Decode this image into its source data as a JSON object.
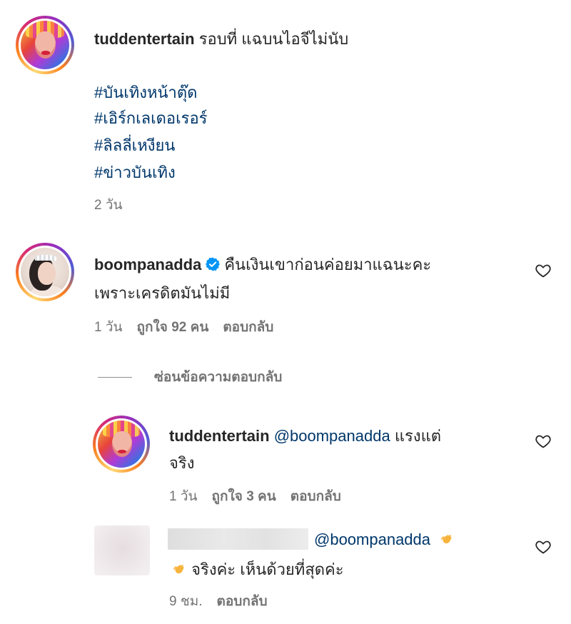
{
  "comments": [
    {
      "username": "tuddentertain",
      "text": "รอบที่ แฉบนไอจีไม่นับ",
      "hashtags": [
        "#บันเทิงหน้าตุ๊ด",
        "#เอิร์กเลเดอเรอร์",
        "#ลิลลี่เหงียน",
        "#ข่าวบันเทิง"
      ],
      "time": "2 วัน"
    },
    {
      "username": "boompanadda",
      "verified": true,
      "text_line1": "คืนเงินเขาก่อนค่อยมาแฉนะคะ",
      "text_line2": "เพราะเครดิตมันไม่มี",
      "time": "1 วัน",
      "likes": "ถูกใจ 92 คน",
      "reply": "ตอบกลับ"
    }
  ],
  "hide_replies_label": "ซ่อนข้อความตอบกลับ",
  "replies": [
    {
      "username": "tuddentertain",
      "mention": "@boompanadda",
      "text_line1_suffix": "แรงแต่",
      "text_line2": "จริง",
      "time": "1 วัน",
      "likes": "ถูกใจ 3 คน",
      "reply": "ตอบกลับ"
    },
    {
      "mention": "@boompanadda",
      "text_line2": "จริงค่ะ เห็นด้วยที่สุดค่ะ",
      "time": "9 ชม.",
      "reply": "ตอบกลับ"
    }
  ],
  "colors": {
    "link": "#00376b",
    "meta": "#737373",
    "verified": "#0095f6"
  },
  "icons": {
    "like": "heart-icon",
    "verified": "verified-badge-icon",
    "clap": "clapping-hands-emoji"
  }
}
